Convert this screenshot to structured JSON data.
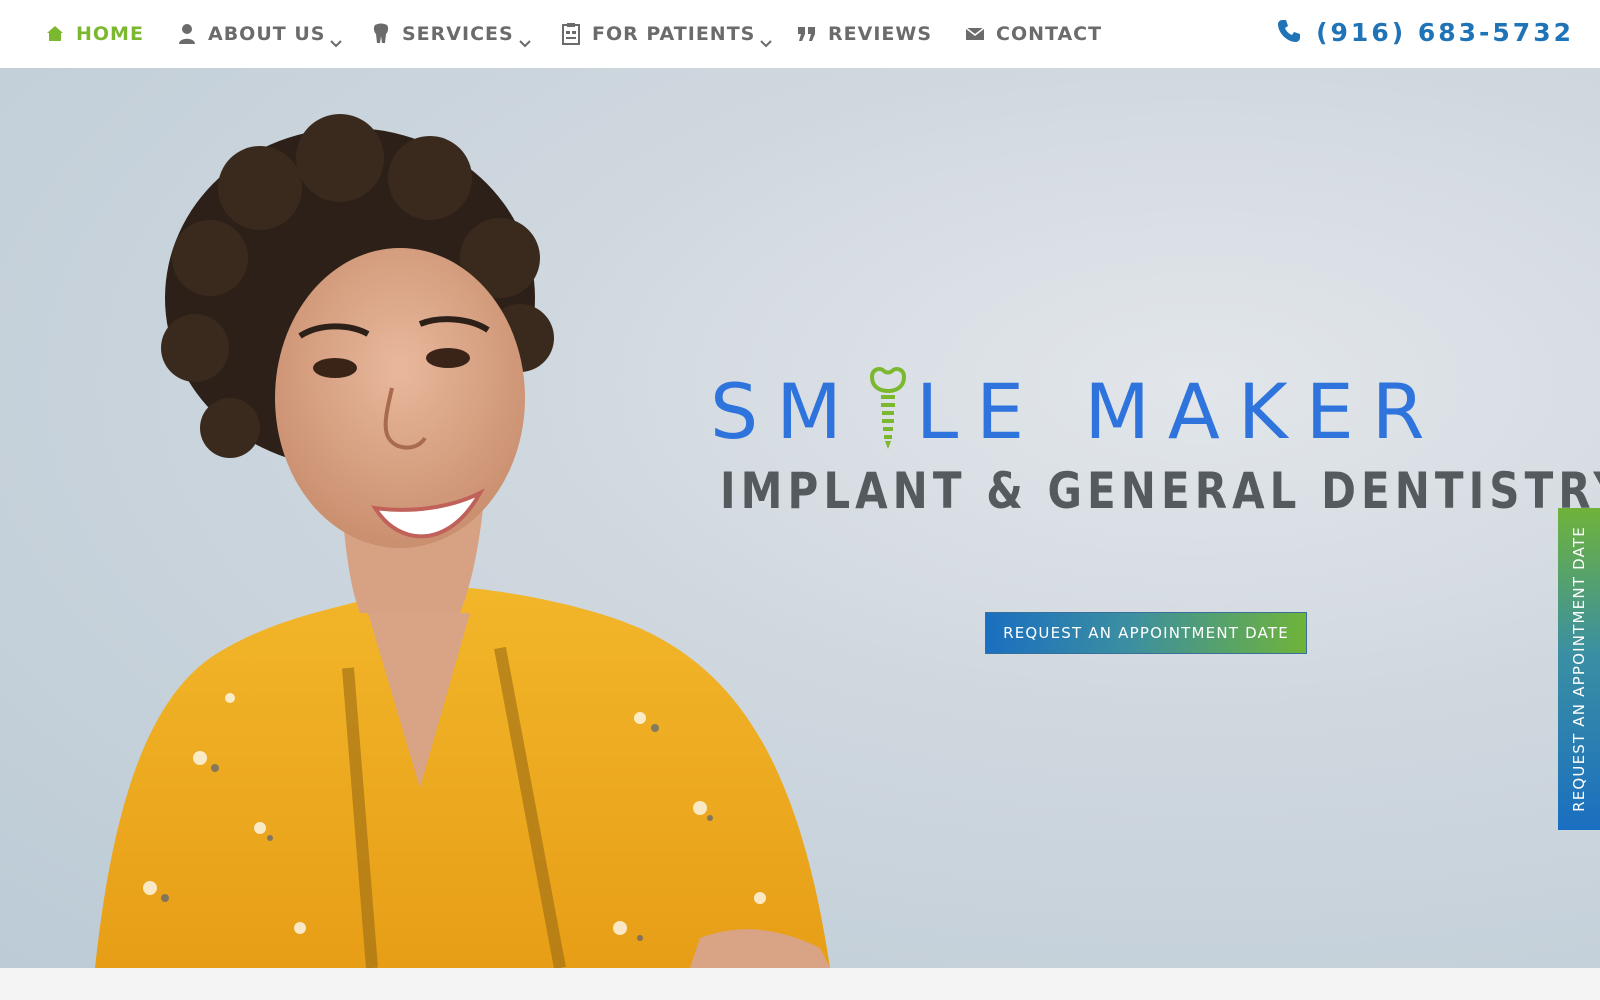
{
  "nav": {
    "items": [
      {
        "label": "HOME",
        "icon": "home-icon",
        "active": true,
        "dropdown": false
      },
      {
        "label": "ABOUT US",
        "icon": "person-icon",
        "active": false,
        "dropdown": true
      },
      {
        "label": "SERVICES",
        "icon": "tooth-icon",
        "active": false,
        "dropdown": true
      },
      {
        "label": "FOR PATIENTS",
        "icon": "clipboard-icon",
        "active": false,
        "dropdown": true
      },
      {
        "label": "REVIEWS",
        "icon": "quote-icon",
        "active": false,
        "dropdown": false
      },
      {
        "label": "CONTACT",
        "icon": "envelope-icon",
        "active": false,
        "dropdown": false
      }
    ],
    "phone": "(916) 683-5732",
    "phone_icon": "phone-icon"
  },
  "hero": {
    "logo_part1": "SM",
    "logo_part2": "LE MAKER",
    "logo_icon": "dental-implant-icon",
    "tagline": "IMPLANT & GENERAL DENTISTRY",
    "cta_label": "REQUEST AN APPOINTMENT DATE",
    "side_tab_label": "REQUEST AN APPOINTMENT DATE"
  },
  "colors": {
    "accent_green": "#7cb82f",
    "brand_blue": "#2f74dc",
    "phone_blue": "#1f73b7",
    "nav_text": "#6b6b6b",
    "tagline_gray": "#555a5e"
  }
}
